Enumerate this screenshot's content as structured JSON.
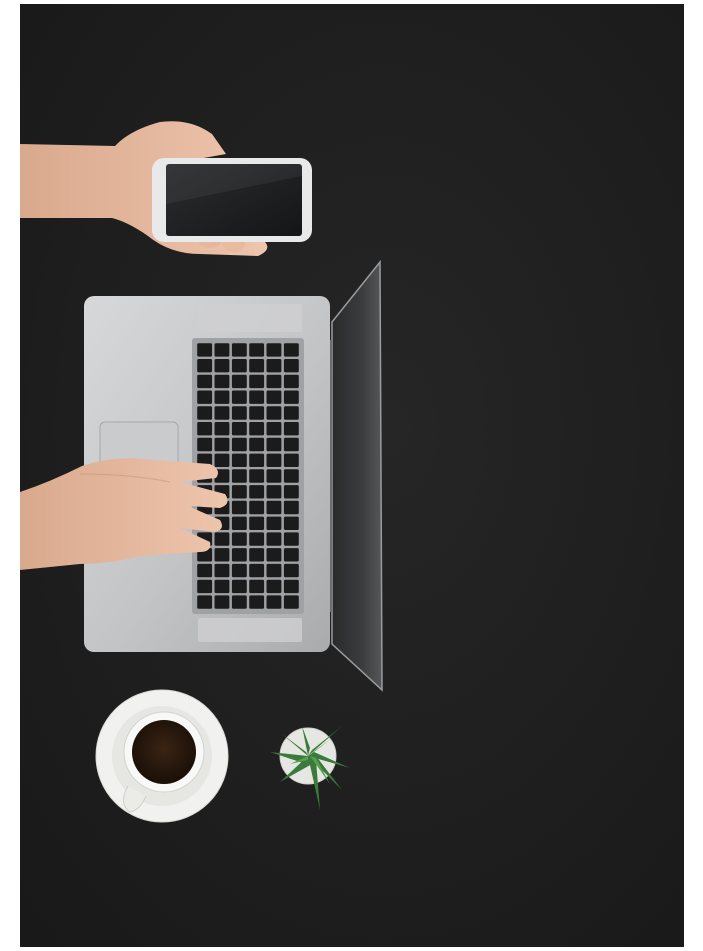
{
  "scene": {
    "background_color": "#1e1e1e",
    "frame_color": "#ffffff",
    "objects": [
      "phone-in-hand",
      "laptop",
      "hand-on-keyboard",
      "coffee-cup-with-saucer",
      "potted-succulent"
    ]
  },
  "colors": {
    "desk": "#1e1e1e",
    "aluminum": "#bfc1c3",
    "key": "#1b1b1b",
    "skin": "#e3b59a",
    "plant": "#3a7a3a"
  }
}
